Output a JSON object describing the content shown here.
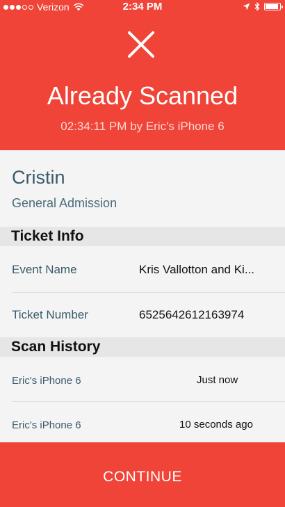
{
  "status_bar": {
    "carrier": "Verizon",
    "time": "2:34 PM"
  },
  "header": {
    "title": "Already Scanned",
    "subtitle": "02:34:11 PM by Eric's iPhone 6",
    "icon": "close-x-icon"
  },
  "attendee": {
    "name": "Cristin",
    "ticket_type": "General Admission"
  },
  "ticket_info": {
    "heading": "Ticket Info",
    "rows": [
      {
        "label": "Event Name",
        "value": "Kris Vallotton and Ki..."
      },
      {
        "label": "Ticket Number",
        "value": "6525642612163974"
      }
    ]
  },
  "scan_history": {
    "heading": "Scan History",
    "rows": [
      {
        "device": "Eric's iPhone 6",
        "when": "Just now"
      },
      {
        "device": "Eric's iPhone 6",
        "when": "10 seconds ago"
      }
    ]
  },
  "continue_button": {
    "label": "CONTINUE"
  },
  "colors": {
    "accent_red": "#f04438",
    "label_blue": "#3a5a6a",
    "background": "#f4f4f4"
  }
}
